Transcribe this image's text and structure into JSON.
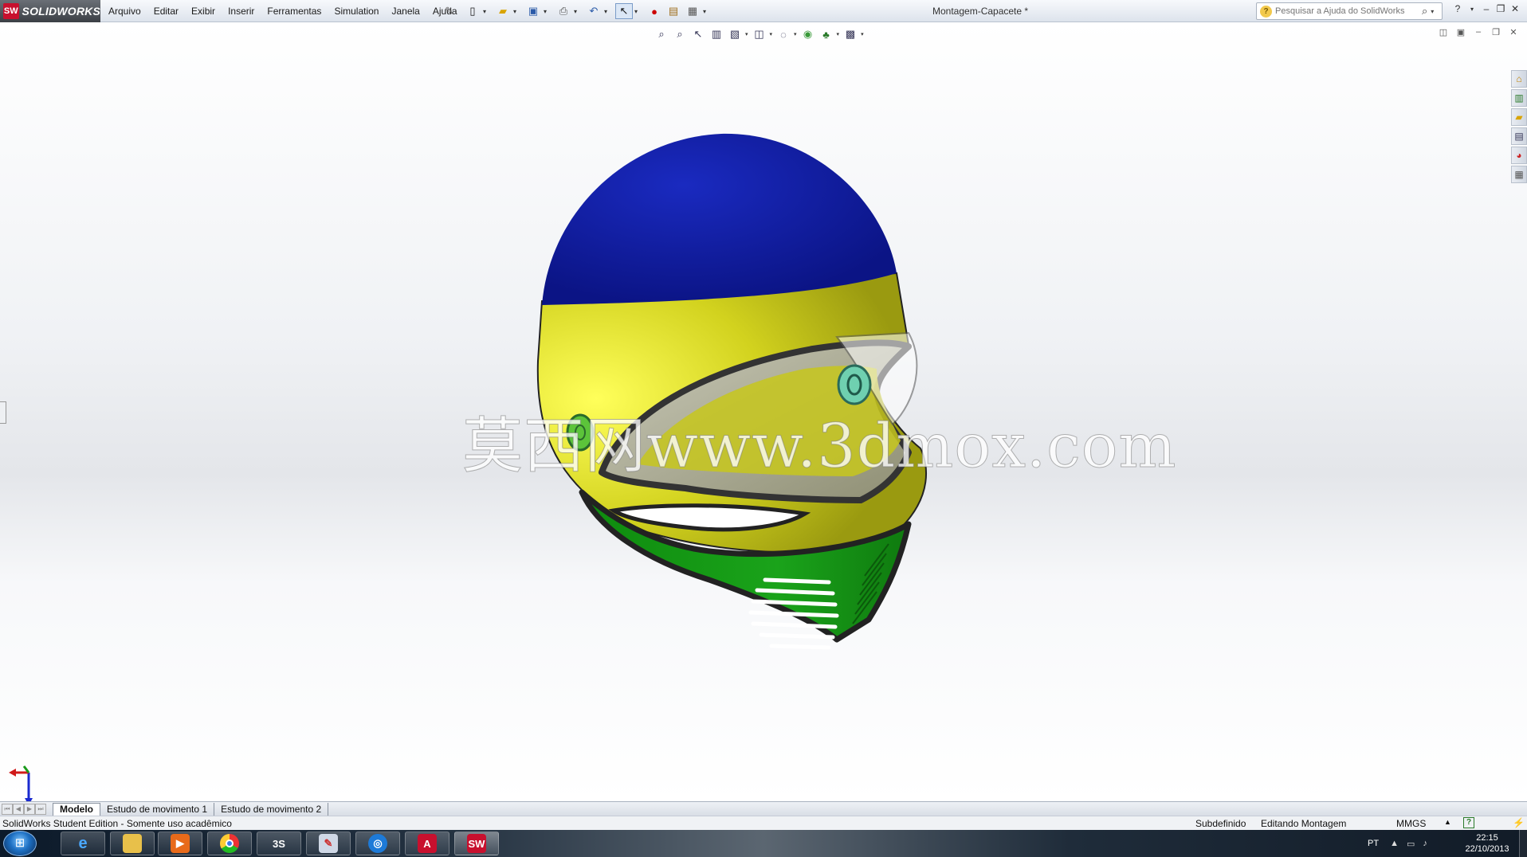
{
  "app": {
    "logo_text": "SOLIDWORKS",
    "document_title": "Montagem-Capacete *"
  },
  "menu": {
    "items": [
      "Arquivo",
      "Editar",
      "Exibir",
      "Inserir",
      "Ferramentas",
      "Simulation",
      "Janela",
      "Ajuda"
    ]
  },
  "search": {
    "placeholder": "Pesquisar a Ajuda do SolidWorks"
  },
  "tabs": {
    "items": [
      "Modelo",
      "Estudo de movimento 1",
      "Estudo de movimento 2"
    ],
    "active": "Modelo"
  },
  "watermark": {
    "text": "莫西网www.3dmox.com"
  },
  "status": {
    "edition": "SolidWorks Student Edition - Somente uso acadêmico",
    "definition": "Subdefinido",
    "mode": "Editando Montagem",
    "units": "MMGS"
  },
  "taskbar": {
    "language": "PT",
    "time": "22:15",
    "date": "22/10/2013"
  },
  "colors": {
    "helmet_top": "#0c1696",
    "helmet_band": "#d2d21e",
    "helmet_chin": "#1aa31a",
    "edge": "#2a2a2a",
    "accent": "#c8102e"
  },
  "icons": {
    "quick_access": [
      "new-document-icon",
      "open-folder-icon",
      "save-icon",
      "print-icon",
      "undo-icon",
      "select-arrow-icon",
      "traffic-light-icon",
      "file-properties-icon",
      "options-icon"
    ],
    "heads_up": [
      "zoom-to-fit-icon",
      "zoom-to-area-icon",
      "previous-view-icon",
      "section-view-icon",
      "view-orientation-icon",
      "display-style-icon",
      "hide-show-icon",
      "edit-appearance-icon",
      "apply-scene-icon",
      "view-settings-icon"
    ],
    "task_pane": [
      "solidworks-resources-icon",
      "design-library-icon",
      "file-explorer-icon",
      "view-palette-icon",
      "appearances-icon",
      "custom-properties-icon"
    ]
  }
}
